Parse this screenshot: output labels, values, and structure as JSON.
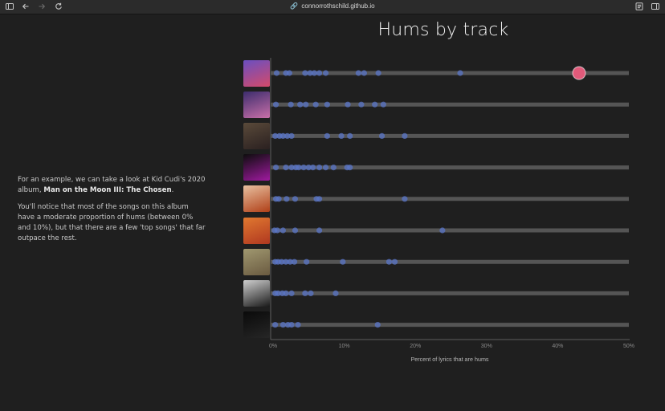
{
  "browser": {
    "url": "connorrothschild.github.io",
    "icons": [
      "sidebar-icon",
      "back-arrow-icon",
      "forward-arrow-icon",
      "reload-icon",
      "link-icon",
      "reader-icon",
      "sidebar-right-icon"
    ]
  },
  "text": {
    "p1_before": "For an example, we can take a look at Kid Cudi's 2020 album, ",
    "p1_album": "Man on the Moon III: The Chosen",
    "p1_after": ".",
    "p2": "You'll notice that most of the songs on this album have a moderate proportion of hums (between 0% and 10%), but that there are a few 'top songs' that far outpace the rest."
  },
  "chart_data": {
    "type": "scatter",
    "title": "Hums by track",
    "xlabel": "Percent of lyrics that are hums",
    "x_ticks": [
      "0%",
      "10%",
      "20%",
      "30%",
      "40%",
      "50%"
    ],
    "xlim": [
      0,
      50
    ],
    "grid": false,
    "colors": {
      "dot": "#5a76c8",
      "highlight": "#e05a7a",
      "track_line": "#555555"
    },
    "covers": [
      {
        "top": "#6a4fc1",
        "bottom": "#d44a6a"
      },
      {
        "top": "#3d2d6d",
        "bottom": "#c86fa8"
      },
      {
        "top": "#5a4a3a",
        "bottom": "#2a2020"
      },
      {
        "top": "#0d0d0d",
        "bottom": "#a01aa0"
      },
      {
        "top": "#e8c0a0",
        "bottom": "#b04018"
      },
      {
        "top": "#e07830",
        "bottom": "#b03820"
      },
      {
        "top": "#a09870",
        "bottom": "#6a5a40"
      },
      {
        "top": "#cfcfcf",
        "bottom": "#1a1a1a"
      },
      {
        "top": "#0a0a0a",
        "bottom": "#262626"
      }
    ],
    "rows": [
      {
        "values": [
          0.5,
          1.8,
          2.3,
          4.5,
          5.2,
          5.8,
          6.5,
          7.4,
          12.0,
          12.8,
          14.8,
          26.3
        ],
        "highlight": 43.0
      },
      {
        "values": [
          0.4,
          2.5,
          3.8,
          4.6,
          6.0,
          7.6,
          10.5,
          12.4,
          14.3,
          15.5
        ]
      },
      {
        "values": [
          0.3,
          0.9,
          1.4,
          2.0,
          2.6,
          7.6,
          9.6,
          10.8,
          15.3,
          18.5
        ]
      },
      {
        "values": [
          0.4,
          1.8,
          2.6,
          3.2,
          3.6,
          4.3,
          5.0,
          5.6,
          6.5,
          7.4,
          8.5,
          10.4,
          10.8
        ]
      },
      {
        "values": [
          0.4,
          0.8,
          1.9,
          3.1,
          6.1,
          6.5,
          18.5
        ]
      },
      {
        "values": [
          0.2,
          0.6,
          1.4,
          3.1,
          6.5,
          23.8
        ]
      },
      {
        "values": [
          0.3,
          0.7,
          1.2,
          1.8,
          2.4,
          3.0,
          4.7,
          9.8,
          16.3,
          17.1
        ]
      },
      {
        "values": [
          0.3,
          0.7,
          1.3,
          1.8,
          2.6,
          4.5,
          5.3,
          8.8
        ]
      },
      {
        "values": [
          0.3,
          1.4,
          2.1,
          2.6,
          3.5,
          14.7
        ]
      }
    ]
  }
}
